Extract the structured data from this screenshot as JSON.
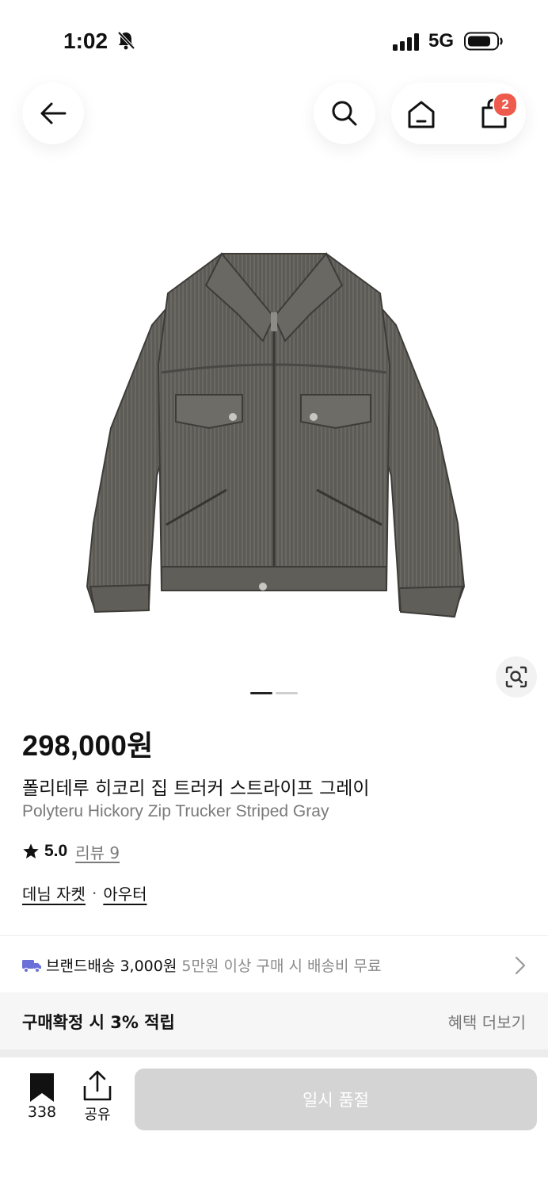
{
  "status_bar": {
    "time": "1:02",
    "network": "5G"
  },
  "header": {
    "cart_count": "2"
  },
  "product": {
    "price": "298,000원",
    "name_ko": "폴리테루 히코리 집 트러커 스트라이프 그레이",
    "name_en": "Polyteru Hickory Zip Trucker Striped Gray",
    "rating": "5.0",
    "reviews_label": "리뷰 9",
    "categories": [
      "데님 자켓",
      "아우터"
    ],
    "category_separator": "·",
    "image_dots": {
      "total": 2,
      "active": 1
    }
  },
  "shipping": {
    "label": "브랜드배송 3,000원",
    "condition": "5만원 이상 구매 시 배송비 무료"
  },
  "benefit": {
    "text": "구매확정 시 3% 적립",
    "more": "혜택 더보기"
  },
  "bottom_bar": {
    "bookmark_count": "338",
    "share_label": "공유",
    "cta_label": "일시 품절"
  },
  "colors": {
    "badge": "#ee5b4c",
    "disabled_button": "#d4d4d4",
    "truck": "#6b6fd8"
  }
}
